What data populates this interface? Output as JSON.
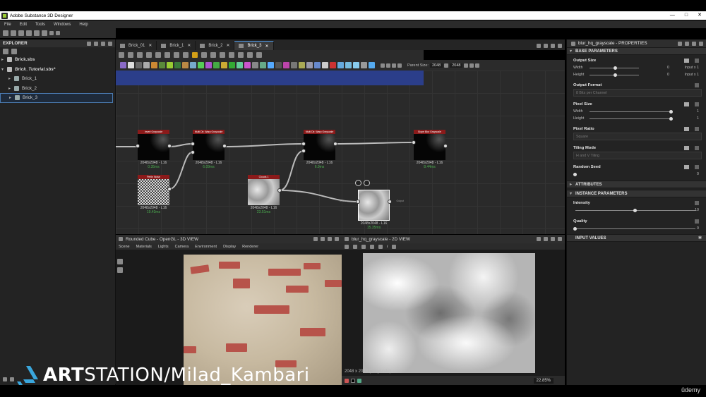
{
  "window": {
    "title": "Adobe Substance 3D Designer",
    "controls": [
      "—",
      "□",
      "✕"
    ]
  },
  "menu": [
    "File",
    "Edit",
    "Tools",
    "Windows",
    "Help"
  ],
  "explorer": {
    "title": "EXPLORER",
    "items": [
      {
        "label": "Brick.sbs",
        "level": 0,
        "arrow": "▸"
      },
      {
        "label": "Brick_Tutorial.sbs*",
        "level": 0,
        "arrow": "▾"
      },
      {
        "label": "Brick_1",
        "level": 1,
        "arrow": "▸"
      },
      {
        "label": "Brick_2",
        "level": 1,
        "arrow": "▸"
      },
      {
        "label": "Brick_3",
        "level": 1,
        "arrow": "▸",
        "selected": true
      }
    ]
  },
  "tabs": [
    "Brick_01",
    "Brick_1",
    "Brick_2",
    "Brick_3"
  ],
  "graph_toolbar": {
    "parent_size_label": "Parent Size:",
    "parent_size": "2048",
    "size2": "2048"
  },
  "nodes": [
    {
      "title": "Invert Grayscale",
      "res": "2048x2048 - L16",
      "time": "0.35ms",
      "style": "black"
    },
    {
      "title": "Multi Dir. Warp Grayscale",
      "res": "2048x2048 - L16",
      "time": "6.09ms",
      "style": "black"
    },
    {
      "title": "Multi Dir. Warp Grayscale",
      "res": "2048x2048 - L16",
      "time": "6.9ms",
      "style": "black"
    },
    {
      "title": "Slope Blur Grayscale",
      "res": "2048x2048 - L16",
      "time": "8.44ms",
      "style": "black"
    },
    {
      "title": "Perlin Noise",
      "res": "2048x2048 - L16",
      "time": "19.43ms",
      "style": "noise"
    },
    {
      "title": "Clouds 1",
      "res": "2048x2048 - L16",
      "time": "23.51ms",
      "style": "cloud"
    },
    {
      "title": "Blur HQ",
      "res": "2048x2048 - L16",
      "time": "15.35ms",
      "style": "cloud",
      "in_label": "Source",
      "out_label": "Output"
    }
  ],
  "view3d": {
    "title": "Rounded Cube - OpenGL - 3D VIEW",
    "menu": [
      "Scene",
      "Materials",
      "Lights",
      "Camera",
      "Environment",
      "Display",
      "Renderer"
    ]
  },
  "view2d": {
    "title": "blur_hq_grayscale - 2D VIEW",
    "res_text": "2048 x 2048 (Grayscale)",
    "zoom": "22.85%"
  },
  "properties": {
    "title": "blur_hq_grayscale - PROPERTIES",
    "sections": {
      "base": "BASE PARAMETERS",
      "attributes": "ATTRIBUTES",
      "instance": "INSTANCE PARAMETERS",
      "input": "INPUT VALUES"
    },
    "output_size": {
      "label": "Output Size",
      "width_label": "Width",
      "width_value": "0",
      "width_mode": "Input x 1",
      "height_label": "Height",
      "height_value": "0",
      "height_mode": "Input x 1"
    },
    "output_format": {
      "label": "Output Format",
      "value": "8 Bits per Channel"
    },
    "pixel_size": {
      "label": "Pixel Size",
      "width_label": "Width",
      "width_value": "1",
      "height_label": "Height",
      "height_value": "1"
    },
    "pixel_ratio": {
      "label": "Pixel Ratio",
      "value": "Square"
    },
    "tiling_mode": {
      "label": "Tiling Mode",
      "value": "H and V Tiling"
    },
    "random_seed": {
      "label": "Random Seed",
      "value": "0"
    },
    "intensity": {
      "label": "Intensity",
      "value": "10",
      "fraction": 0.5
    },
    "quality": {
      "label": "Quality",
      "value": "0",
      "fraction": 0.0
    }
  },
  "watermark": {
    "prefix": "ART",
    "rest": "STATION/Milad_Kambari",
    "brand": "ûdemy"
  },
  "colors": {
    "accent": "#4a90d9",
    "node_header": "#8b1a1a",
    "frame": "#2b3e8a",
    "time_green": "#4caf50"
  }
}
